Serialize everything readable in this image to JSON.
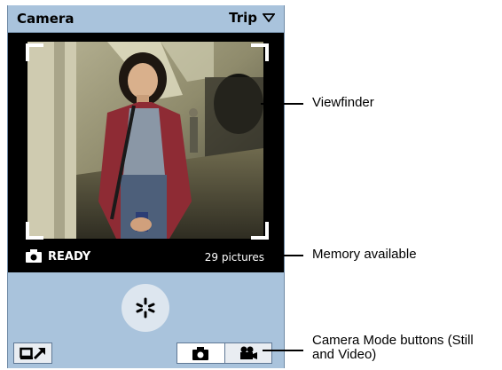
{
  "app": {
    "title": "Camera",
    "category": "Trip"
  },
  "viewfinder": {
    "status": "READY",
    "memory": "29 pictures"
  },
  "callouts": {
    "viewfinder": "Viewfinder",
    "memory": "Memory available",
    "mode_line1": "Camera Mode buttons (Still",
    "mode_line2": "and Video)"
  },
  "colors": {
    "chrome": "#a9c3dc",
    "screen": "#000000",
    "button": "#e9edf2",
    "selected_button": "#ffffff"
  },
  "icons": {
    "category_dropdown": "triangle-down-icon",
    "status": "camera-icon",
    "shutter": "shutter-icon",
    "view_pictures": "view-pictures-icon",
    "still_mode": "camera-icon",
    "video_mode": "video-camera-icon"
  },
  "modes": {
    "selected": "still"
  }
}
